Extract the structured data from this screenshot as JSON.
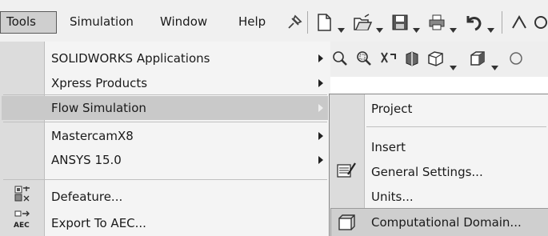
{
  "menubar": {
    "items": [
      {
        "label": "Tools"
      },
      {
        "label": "Simulation"
      },
      {
        "label": "Window"
      },
      {
        "label": "Help"
      }
    ],
    "toolbar_icons": [
      "pin-icon",
      "new-document-icon",
      "open-icon",
      "save-icon",
      "print-icon",
      "undo-icon"
    ]
  },
  "toolbar2": {
    "icons": [
      "zoom-to-fit-icon",
      "zoom-to-area-icon",
      "previous-view-icon",
      "section-view-icon",
      "view-orientation-icon",
      "display-style-icon"
    ]
  },
  "tools_menu": {
    "items": [
      {
        "label": "SOLIDWORKS Applications",
        "has_submenu": true
      },
      {
        "label": "Xpress Products",
        "has_submenu": true
      },
      {
        "label": "Flow Simulation",
        "has_submenu": true,
        "highlighted": true
      },
      {
        "label": "MastercamX8",
        "has_submenu": true
      },
      {
        "label": "ANSYS 15.0",
        "has_submenu": true
      },
      {
        "label": "Defeature...",
        "icon": "defeature-icon"
      },
      {
        "label": "Export To AEC...",
        "icon": "export-aec-icon"
      }
    ]
  },
  "flow_submenu": {
    "items": [
      {
        "label": "Project"
      },
      {
        "label": "Insert"
      },
      {
        "label": "General Settings...",
        "icon": "general-settings-icon"
      },
      {
        "label": "Units..."
      },
      {
        "label": "Computational Domain...",
        "icon": "computational-domain-icon",
        "highlighted": true
      }
    ]
  },
  "colors": {
    "menubar_bg": "#f0f0f0",
    "menu_bg": "#f4f4f4",
    "gutter_bg": "#dcdcdc",
    "highlight_bg": "#c9c9c9"
  }
}
